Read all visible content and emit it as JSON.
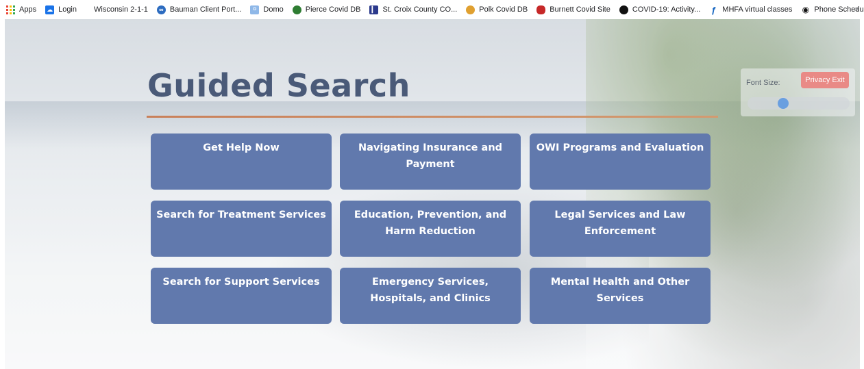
{
  "bookmarks": [
    {
      "label": "Apps",
      "icon": "apps-grid-icon",
      "color": "#ea4335"
    },
    {
      "label": "Login",
      "icon": "cloud-icon",
      "color": "#1a73e8"
    },
    {
      "label": "Wisconsin 2-1-1",
      "icon": "",
      "color": ""
    },
    {
      "label": "Bauman Client Port...",
      "icon": "bauman-icon",
      "color": "#2d6cc0"
    },
    {
      "label": "Domo",
      "icon": "domo-icon",
      "color": "#8fb8e8"
    },
    {
      "label": "Pierce Covid DB",
      "icon": "globe-icon",
      "color": "#2e7d32"
    },
    {
      "label": "St. Croix County CO...",
      "icon": "bar-chart-icon",
      "color": "#2b3a8c"
    },
    {
      "label": "Polk Covid DB",
      "icon": "polk-icon",
      "color": "#e0a030"
    },
    {
      "label": "Burnett Covid Site",
      "icon": "burnett-icon",
      "color": "#c62828"
    },
    {
      "label": "COVID-19: Activity...",
      "icon": "covid-icon",
      "color": "#111111"
    },
    {
      "label": "MHFA virtual classes",
      "icon": "mhfa-icon",
      "color": "#1565c0"
    },
    {
      "label": "Phone Schedule ap...",
      "icon": "phone-schedule-icon",
      "color": "#111111"
    }
  ],
  "bookmarks_overflow": "»",
  "page": {
    "title": "Guided Search",
    "buttons": [
      [
        "Get Help Now",
        "Navigating Insurance and Payment",
        "OWI Programs and Evaluation"
      ],
      [
        "Search for Treatment Services",
        "Education, Prevention, and Harm Reduction",
        "Legal Services and Law Enforcement"
      ],
      [
        "Search for Support Services",
        "Emergency Services, Hospitals, and Clinics",
        "Mental Health and Other Services"
      ]
    ]
  },
  "font_size": {
    "label": "Font Size:",
    "privacy_exit": "Privacy Exit",
    "slider_value": 0.33
  },
  "colors": {
    "button_bg": "#6179ad",
    "title": "#4a5a78",
    "title_rule": "#c9805a",
    "privacy": "#e98a86",
    "slider_thumb": "#6a9fe0"
  }
}
